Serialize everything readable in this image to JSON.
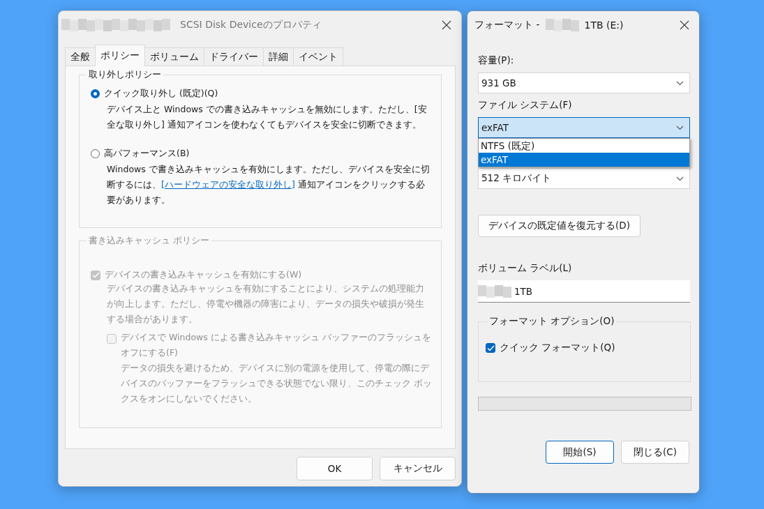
{
  "properties_window": {
    "title": "SCSI Disk Deviceのプロパティ",
    "tabs": [
      {
        "label": "全般",
        "selected": false
      },
      {
        "label": "ポリシー",
        "selected": true
      },
      {
        "label": "ボリューム",
        "selected": false
      },
      {
        "label": "ドライバー",
        "selected": false
      },
      {
        "label": "詳細",
        "selected": false
      },
      {
        "label": "イベント",
        "selected": false
      }
    ],
    "removal_policy": {
      "title": "取り外しポリシー",
      "options": [
        {
          "label": "クイック取り外し (既定)(Q)",
          "selected": true,
          "description": [
            {
              "kind": "text",
              "text": "デバイス上と Windows での書き込みキャッシュを無効にします。ただし、[安全な取り外し] 通知アイコンを使わなくてもデバイスを安全に切断できます。"
            }
          ]
        },
        {
          "label": "高パフォーマンス(B)",
          "selected": false,
          "description": [
            {
              "kind": "text",
              "text": "Windows で書き込みキャッシュを有効にします。ただし、デバイスを安全に切断するには、"
            },
            {
              "kind": "link",
              "text": "[ハードウェアの安全な取り外し]"
            },
            {
              "kind": "text",
              "text": " 通知アイコンをクリックする必要があります。"
            }
          ]
        }
      ]
    },
    "write_cache_policy": {
      "title": "書き込みキャッシュ ポリシー",
      "disabled": true,
      "enable_cache": {
        "label": "デバイスの書き込みキャッシュを有効にする(W)",
        "checked": true,
        "description": "デバイスの書き込みキャッシュを有効にすることにより、システムの処理能力が向上します。ただし、停電や機器の障害により、データの損失や破損が発生する場合があります。"
      },
      "turn_off_flush": {
        "label": "デバイスで Windows による書き込みキャッシュ バッファーのフラッシュをオフにする(F)",
        "checked": false,
        "description": "データの損失を避けるため、デバイスに別の電源を使用して、停電の際にデバイスのバッファーをフラッシュできる状態でない限り、このチェック ボックスをオンにしないでください。"
      }
    },
    "buttons": [
      "OK",
      "キャンセル"
    ]
  },
  "format_window": {
    "title_prefix": "フォーマット -",
    "title_suffix": "1TB (E:)",
    "capacity": {
      "label": "容量(P):",
      "value": "931 GB"
    },
    "file_system": {
      "label": "ファイル システム(F)",
      "value": "exFAT",
      "expanded": true,
      "options": [
        {
          "label": "NTFS (既定)",
          "selected": false
        },
        {
          "label": "exFAT",
          "selected": true
        }
      ]
    },
    "allocation_unit": {
      "value": "512 キロバイト"
    },
    "restore_button": "デバイスの既定値を復元する(D)",
    "volume_label": {
      "label": "ボリューム ラベル(L)",
      "value": "1TB"
    },
    "format_options": {
      "title": "フォーマット オプション(O)",
      "quick_format": {
        "label": "クイック フォーマット(Q)",
        "checked": true
      }
    },
    "progress": {
      "level": 0
    },
    "buttons": [
      {
        "label": "開始(S)",
        "default": true
      },
      {
        "label": "閉じる(C)",
        "default": false
      }
    ]
  }
}
